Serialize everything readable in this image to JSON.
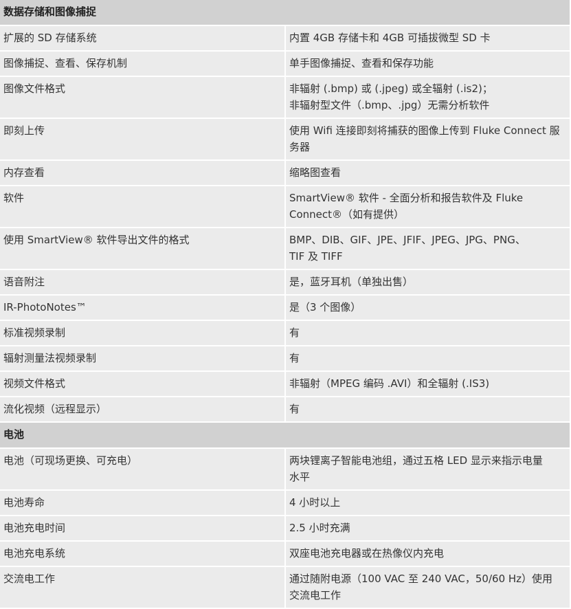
{
  "sections": [
    {
      "title": "数据存储和图像捕捉",
      "rows": [
        {
          "k": "扩展的 SD 存储系统",
          "v": [
            "内置 4GB 存储卡和 4GB 可插拔微型 SD 卡"
          ]
        },
        {
          "k": "图像捕捉、查看、保存机制",
          "v": [
            "单手图像捕捉、查看和保存功能"
          ]
        },
        {
          "k": "图像文件格式",
          "v": [
            "非辐射 (.bmp) 或 (.jpeg) 或全辐射 (.is2)；",
            "非辐射型文件（.bmp、.jpg）无需分析软件"
          ]
        },
        {
          "k": "即刻上传",
          "v": [
            "使用 Wifi 连接即刻将捕获的图像上传到 Fluke Connect 服",
            "务器"
          ]
        },
        {
          "k": "内存查看",
          "v": [
            "缩略图查看"
          ]
        },
        {
          "k": "软件",
          "v": [
            "SmartView® 软件 - 全面分析和报告软件及 Fluke",
            "Connect®（如有提供）"
          ]
        },
        {
          "k": "使用 SmartView® 软件导出文件的格式",
          "v": [
            "BMP、DIB、GIF、JPE、JFIF、JPEG、JPG、PNG、",
            "TIF 及 TIFF"
          ]
        },
        {
          "k": "语音附注",
          "v": [
            "是，蓝牙耳机（单独出售）"
          ]
        },
        {
          "k": "IR-PhotoNotes™",
          "v": [
            "是（3 个图像）"
          ]
        },
        {
          "k": "标准视频录制",
          "v": [
            "有"
          ]
        },
        {
          "k": "辐射测量法视频录制",
          "v": [
            "有"
          ]
        },
        {
          "k": "视频文件格式",
          "v": [
            "非辐射（MPEG 编码 .AVI）和全辐射 (.IS3)"
          ]
        },
        {
          "k": "流化视频（远程显示）",
          "v": [
            "有"
          ]
        }
      ]
    },
    {
      "title": "电池",
      "rows": [
        {
          "k": "电池（可现场更换、可充电）",
          "v": [
            "两块锂离子智能电池组，通过五格 LED 显示来指示电量",
            "水平"
          ]
        },
        {
          "k": "电池寿命",
          "v": [
            "4 小时以上"
          ]
        },
        {
          "k": "电池充电时间",
          "v": [
            "2.5 小时充满"
          ]
        },
        {
          "k": "电池充电系统",
          "v": [
            "双座电池充电器或在热像仪内充电"
          ]
        },
        {
          "k": "交流电工作",
          "v": [
            "通过随附电源（100 VAC 至 240 VAC，50/60 Hz）使用",
            "交流电工作"
          ]
        }
      ]
    }
  ]
}
